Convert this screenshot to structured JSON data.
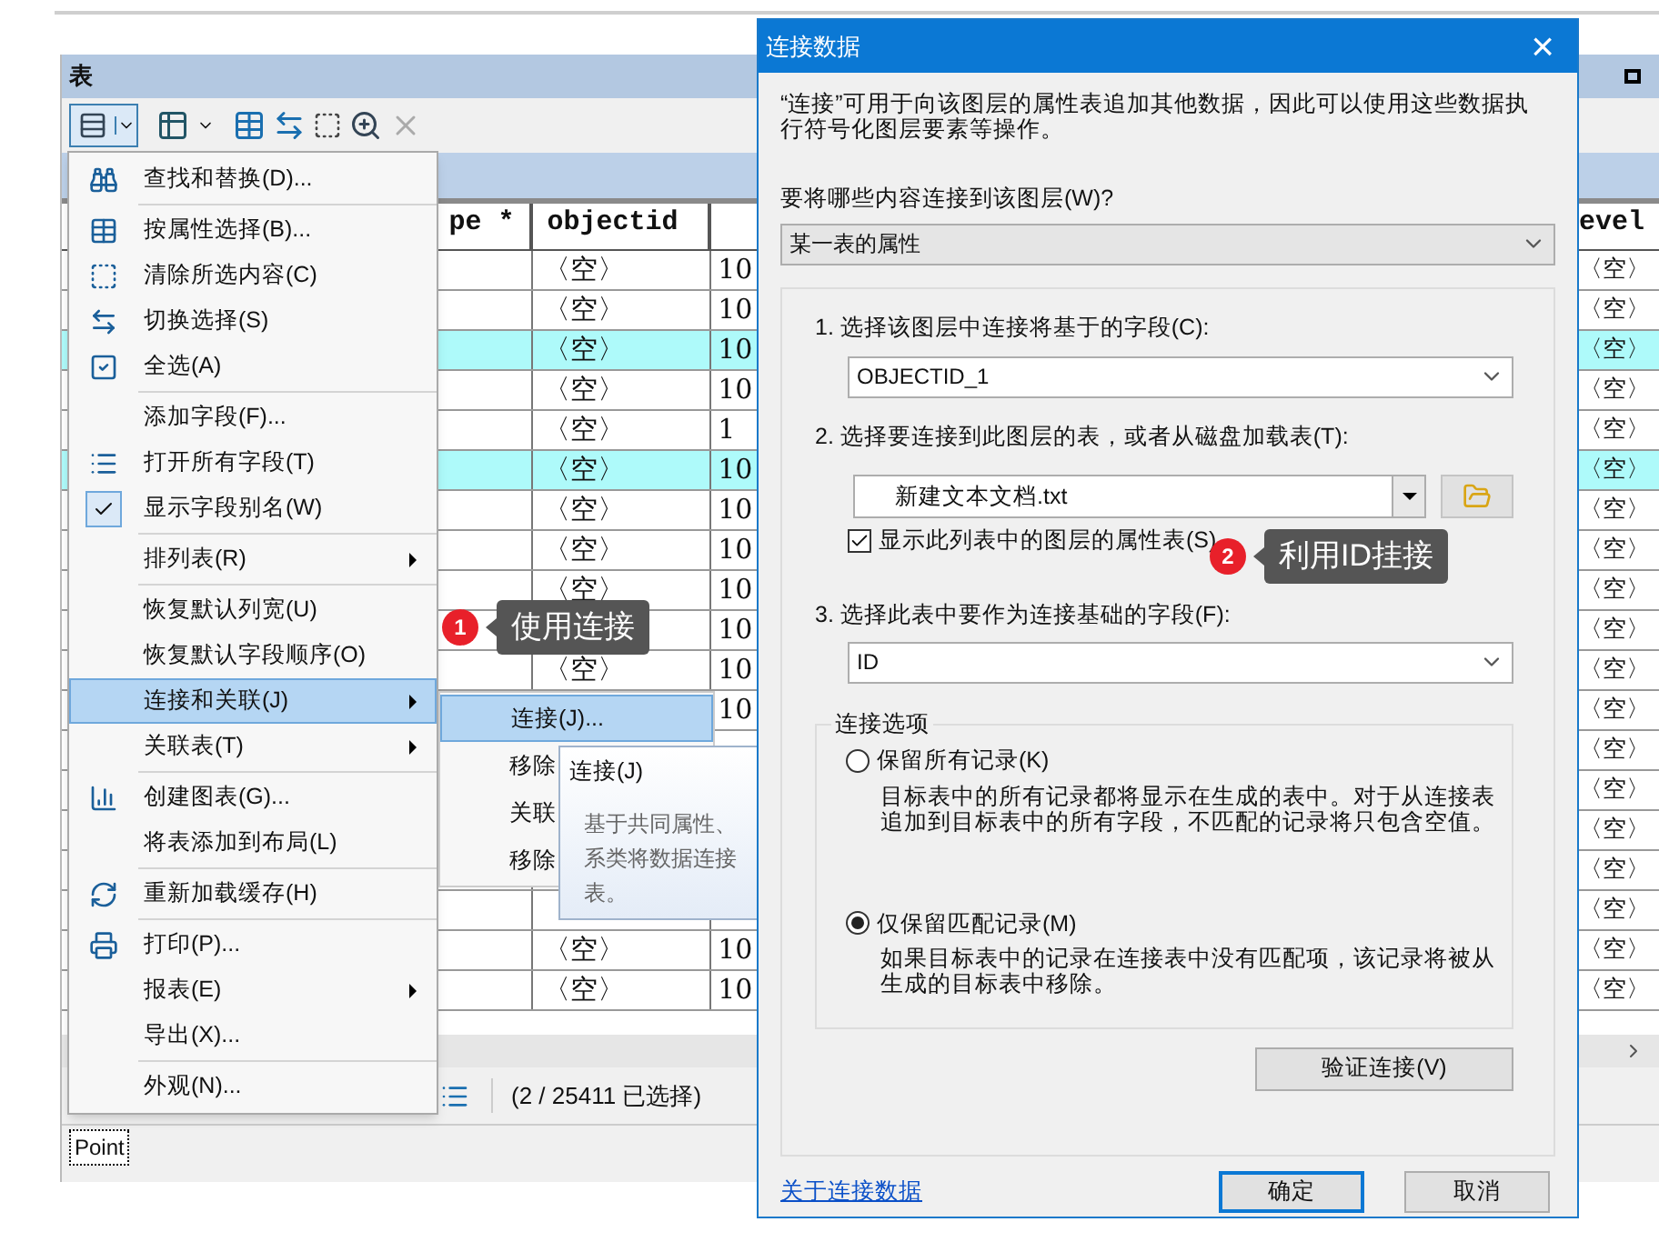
{
  "table_window": {
    "title": "表",
    "columns": {
      "column_1": "pe *",
      "column_2": "objectid",
      "column_4": "evel"
    },
    "rows": [
      {
        "selected": false,
        "column_2": "〈空〉",
        "column_3": "10",
        "column_4": "〈空〉"
      },
      {
        "selected": false,
        "column_2": "〈空〉",
        "column_3": "10",
        "column_4": "〈空〉"
      },
      {
        "selected": true,
        "column_2": "〈空〉",
        "column_3": "10",
        "column_4": "〈空〉"
      },
      {
        "selected": false,
        "column_2": "〈空〉",
        "column_3": "10",
        "column_4": "〈空〉"
      },
      {
        "selected": false,
        "column_2": "〈空〉",
        "column_3": "1",
        "column_4": "〈空〉"
      },
      {
        "selected": true,
        "column_2": "〈空〉",
        "column_3": "10",
        "column_4": "〈空〉"
      },
      {
        "selected": false,
        "column_2": "〈空〉",
        "column_3": "10",
        "column_4": "〈空〉"
      },
      {
        "selected": false,
        "column_2": "〈空〉",
        "column_3": "10",
        "column_4": "〈空〉"
      },
      {
        "selected": false,
        "column_2": "〈空〉",
        "column_3": "10",
        "column_4": "〈空〉"
      },
      {
        "selected": false,
        "column_3": "10",
        "column_4": "〈空〉"
      },
      {
        "selected": false,
        "column_2": "〈空〉",
        "column_3": "10",
        "column_4": "〈空〉"
      },
      {
        "selected": false,
        "column_3": "10",
        "column_4": "〈空〉"
      },
      {
        "selected": false,
        "column_4": "〈空〉"
      },
      {
        "selected": false,
        "column_4": "〈空〉"
      },
      {
        "selected": false,
        "column_4": "〈空〉"
      },
      {
        "selected": false,
        "column_4": "〈空〉"
      },
      {
        "selected": false,
        "column_4": "〈空〉"
      },
      {
        "selected": false,
        "column_2": "〈空〉",
        "column_3": "10",
        "column_4": "〈空〉"
      },
      {
        "selected": false,
        "column_2": "〈空〉",
        "column_3": "10",
        "column_4": "〈空〉"
      }
    ],
    "status": "(2 / 25411 已选择)",
    "layer_tab": "Point"
  },
  "menu": {
    "items": [
      {
        "kind": "item",
        "label": "查找和替换(D)...",
        "submenu": false,
        "checked": false,
        "selected": false
      },
      {
        "kind": "separator"
      },
      {
        "kind": "item",
        "label": "按属性选择(B)...",
        "submenu": false,
        "checked": false,
        "selected": false
      },
      {
        "kind": "item",
        "label": "清除所选内容(C)",
        "submenu": false,
        "checked": false,
        "selected": false
      },
      {
        "kind": "item",
        "label": "切换选择(S)",
        "submenu": false,
        "checked": false,
        "selected": false
      },
      {
        "kind": "item",
        "label": "全选(A)",
        "submenu": false,
        "checked": false,
        "selected": false
      },
      {
        "kind": "separator"
      },
      {
        "kind": "item",
        "label": "添加字段(F)...",
        "submenu": false,
        "checked": false,
        "selected": false
      },
      {
        "kind": "item",
        "label": "打开所有字段(T)",
        "submenu": false,
        "checked": false,
        "selected": false
      },
      {
        "kind": "item",
        "label": "显示字段别名(W)",
        "submenu": false,
        "checked": true,
        "selected": false
      },
      {
        "kind": "separator"
      },
      {
        "kind": "item",
        "label": "排列表(R)",
        "submenu": true,
        "checked": false,
        "selected": false
      },
      {
        "kind": "separator"
      },
      {
        "kind": "item",
        "label": "恢复默认列宽(U)",
        "submenu": false,
        "checked": false,
        "selected": false
      },
      {
        "kind": "item",
        "label": "恢复默认字段顺序(O)",
        "submenu": false,
        "checked": false,
        "selected": false
      },
      {
        "kind": "item",
        "label": "连接和关联(J)",
        "submenu": true,
        "checked": false,
        "selected": true
      },
      {
        "kind": "item",
        "label": "关联表(T)",
        "submenu": true,
        "checked": false,
        "selected": false
      },
      {
        "kind": "separator"
      },
      {
        "kind": "item",
        "label": "创建图表(G)...",
        "submenu": false,
        "checked": false,
        "selected": false
      },
      {
        "kind": "item",
        "label": "将表添加到布局(L)",
        "submenu": false,
        "checked": false,
        "selected": false
      },
      {
        "kind": "separator"
      },
      {
        "kind": "item",
        "label": "重新加载缓存(H)",
        "submenu": false,
        "checked": false,
        "selected": false
      },
      {
        "kind": "separator"
      },
      {
        "kind": "item",
        "label": "打印(P)...",
        "submenu": false,
        "checked": false,
        "selected": false
      },
      {
        "kind": "item",
        "label": "报表(E)",
        "submenu": true,
        "checked": false,
        "selected": false
      },
      {
        "kind": "item",
        "label": "导出(X)...",
        "submenu": false,
        "checked": false,
        "selected": false
      },
      {
        "kind": "separator"
      },
      {
        "kind": "item",
        "label": "外观(N)...",
        "submenu": false,
        "checked": false,
        "selected": false
      }
    ]
  },
  "submenu": {
    "items": [
      {
        "label": "连接(J)...",
        "selected": true
      },
      {
        "label": "移除",
        "selected": false
      },
      {
        "label": "关联",
        "selected": false
      },
      {
        "label": "移除",
        "selected": false
      }
    ]
  },
  "tooltip": {
    "title": "连接(J)",
    "lines": [
      "基于共同属性、",
      "系类将数据连接",
      "表。"
    ]
  },
  "callouts": [
    {
      "number": "1",
      "text": "使用连接"
    },
    {
      "number": "2",
      "text": "利用ID挂接"
    }
  ],
  "dialog": {
    "title": "连接数据",
    "close": "×",
    "description": "“连接”可用于向该图层的属性表追加其他数据，因此可以使用这些数据执行符号化图层要素等操作。",
    "what_label": "要将哪些内容连接到该图层(W)?",
    "what_value": "某一表的属性",
    "step1_label": "1. 选择该图层中连接将基于的字段(C):",
    "step1_value": "OBJECTID_1",
    "step2_label": "2. 选择要连接到此图层的表，或者从磁盘加载表(T):",
    "step2_value": "新建文本文档.txt",
    "show_layers": {
      "label": "显示此列表中的图层的属性表(S)",
      "checked": true
    },
    "step3_label": "3. 选择此表中要作为连接基础的字段(F):",
    "step3_value": "ID",
    "options_title": "连接选项",
    "options": [
      {
        "label": "保留所有记录(K)",
        "description": "目标表中的所有记录都将显示在生成的表中。对于从连接表追加到目标表中的所有字段，不匹配的记录将只包含空值。",
        "selected": false
      },
      {
        "label": "仅保留匹配记录(M)",
        "description": "如果目标表中的记录在连接表中没有匹配项，该记录将被从生成的目标表中移除。",
        "selected": true
      }
    ],
    "validate_button": "验证连接(V)",
    "help_link": "关于连接数据",
    "ok_button": "确定",
    "cancel_button": "取消"
  }
}
